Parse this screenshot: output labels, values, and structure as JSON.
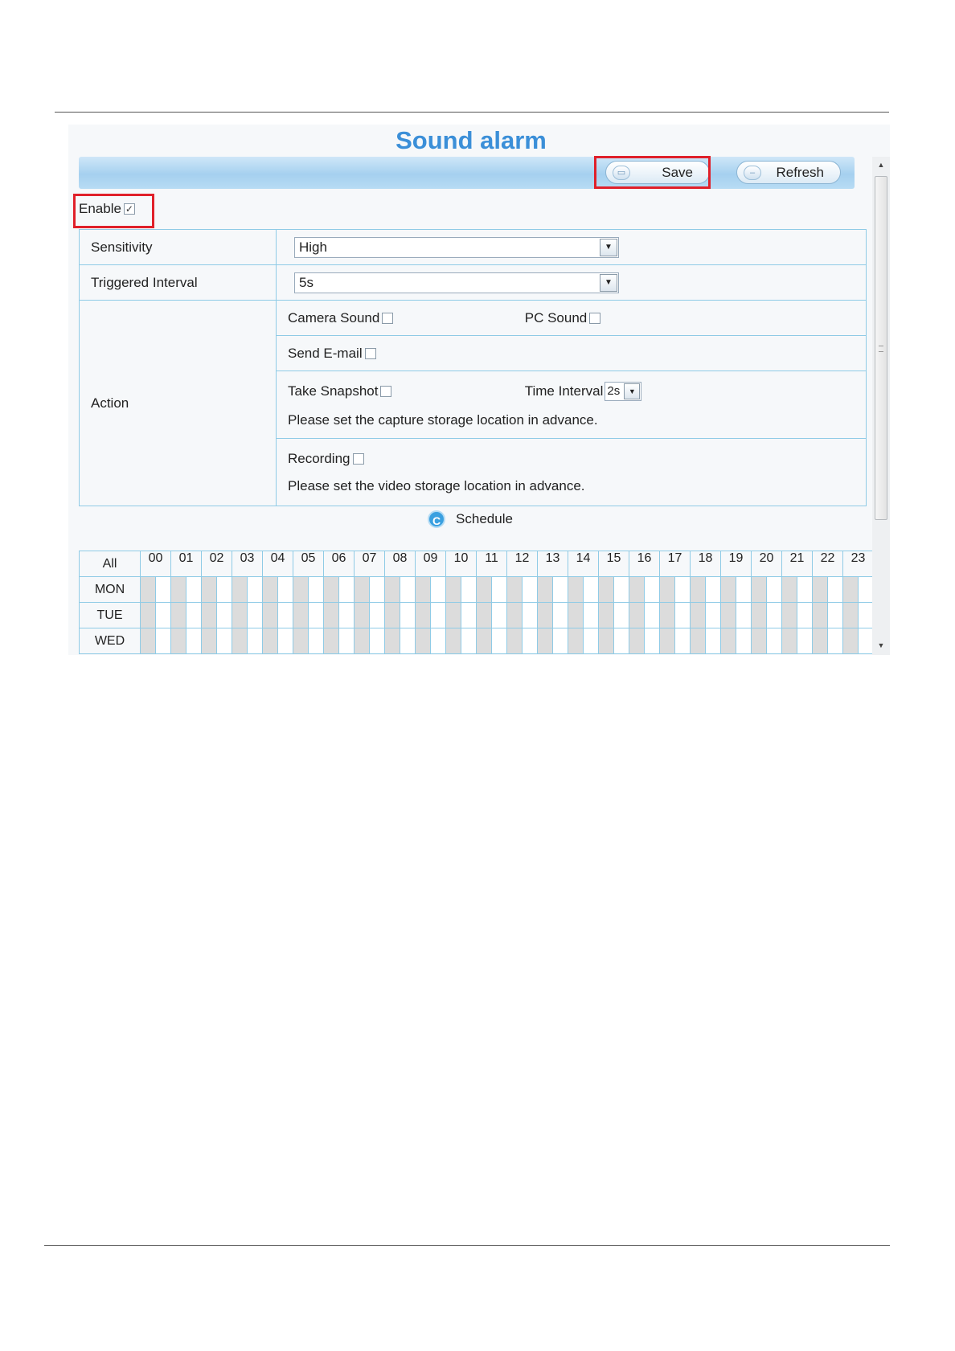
{
  "page": {
    "title": "Sound alarm"
  },
  "toolbar": {
    "save_label": "Save",
    "refresh_label": "Refresh"
  },
  "enable": {
    "label": "Enable",
    "checked": true,
    "check_glyph": "✓"
  },
  "form": {
    "sensitivity": {
      "label": "Sensitivity",
      "value": "High"
    },
    "triggered_interval": {
      "label": "Triggered Interval",
      "value": "5s"
    },
    "action": {
      "label": "Action",
      "camera_sound": "Camera Sound",
      "pc_sound": "PC Sound",
      "send_email": "Send E-mail",
      "take_snapshot": "Take Snapshot",
      "time_interval_label": "Time Interval",
      "time_interval_value": "2s",
      "snapshot_note": "Please set the capture storage location in advance.",
      "recording": "Recording",
      "recording_note": "Please set the video storage location in advance."
    }
  },
  "schedule": {
    "label": "Schedule",
    "icon_glyph": "C",
    "all_label": "All",
    "hours": [
      "00",
      "01",
      "02",
      "03",
      "04",
      "05",
      "06",
      "07",
      "08",
      "09",
      "10",
      "11",
      "12",
      "13",
      "14",
      "15",
      "16",
      "17",
      "18",
      "19",
      "20",
      "21",
      "22",
      "23"
    ],
    "days": [
      "MON",
      "TUE",
      "WED"
    ]
  },
  "icons": {
    "dropdown": "chevron-down-icon",
    "scroll_up": "scroll-up-icon",
    "scroll_down": "scroll-down-icon",
    "schedule": "clock-icon"
  },
  "colors": {
    "title": "#3b8fd8",
    "highlight": "#e0202a",
    "grid_border": "#8fcbe6",
    "toolbar": "#a5d0ef"
  }
}
